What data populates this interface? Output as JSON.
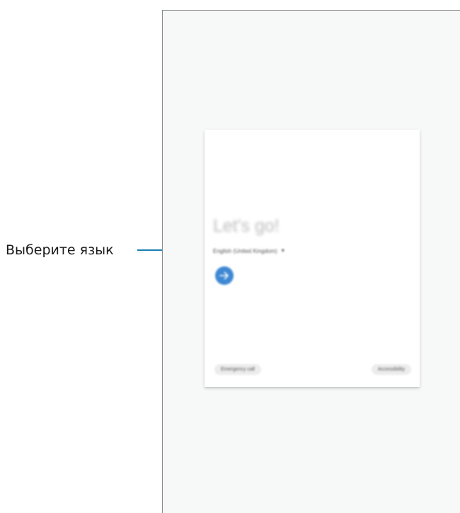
{
  "callout": {
    "label": "Выберите язык"
  },
  "dialog": {
    "heading": "Let's go!",
    "language_value": "English (United Kingdom)",
    "dropdown_caret": "▾",
    "next_icon": "arrow-right-icon",
    "emergency_call_label": "Emergency call",
    "accessibility_label": "Accessibility"
  },
  "colors": {
    "accent": "#3e88d3",
    "callout_line": "#1a7fb5",
    "frame_bg": "#f7f8f8"
  }
}
